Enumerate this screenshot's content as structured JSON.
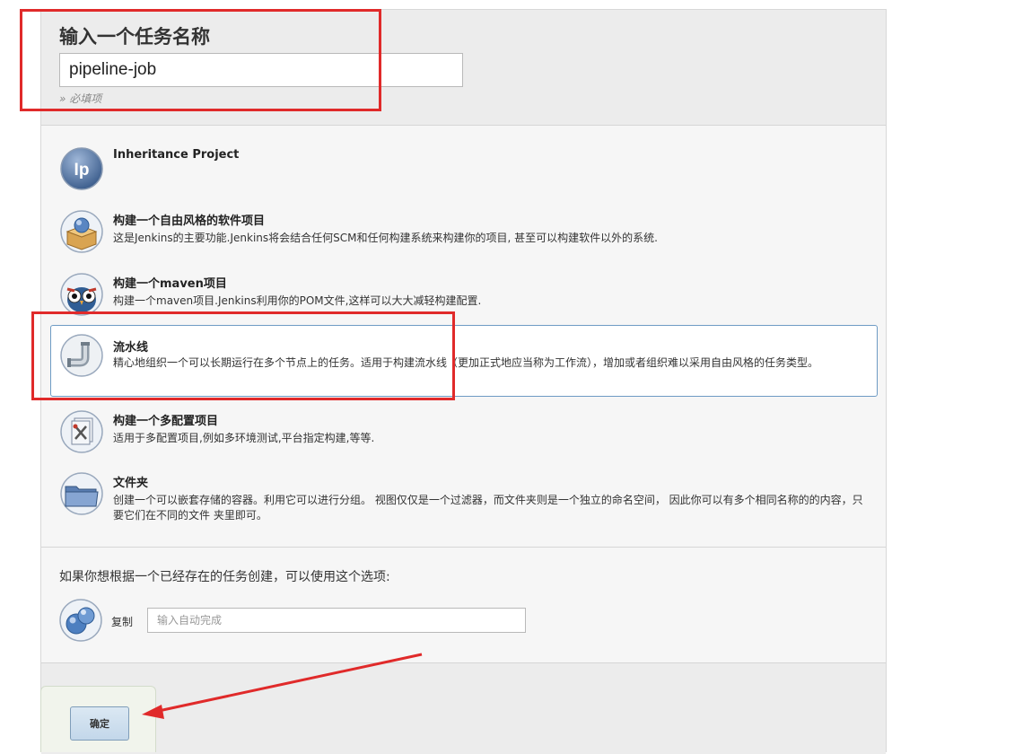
{
  "header": {
    "title": "输入一个任务名称",
    "job_name_value": "pipeline-job",
    "required_hint": "» 必填项"
  },
  "items": [
    {
      "icon": "inheritance-project-icon",
      "icon_text": "Ip",
      "title": "Inheritance Project",
      "desc": ""
    },
    {
      "icon": "freestyle-box-icon",
      "title": "构建一个自由风格的软件项目",
      "desc": "这是Jenkins的主要功能.Jenkins将会结合任何SCM和任何构建系统来构建你的项目, 甚至可以构建软件以外的系统."
    },
    {
      "icon": "maven-owl-icon",
      "title": "构建一个maven项目",
      "desc": "构建一个maven项目.Jenkins利用你的POM文件,这样可以大大减轻构建配置."
    },
    {
      "icon": "pipeline-pipe-icon",
      "title": "流水线",
      "desc": "精心地组织一个可以长期运行在多个节点上的任务。适用于构建流水线（更加正式地应当称为工作流），增加或者组织难以采用自由风格的任务类型。",
      "selected": true
    },
    {
      "icon": "multi-config-icon",
      "title": "构建一个多配置项目",
      "desc": "适用于多配置项目,例如多环境测试,平台指定构建,等等."
    },
    {
      "icon": "folder-icon",
      "title": "文件夹",
      "desc": "创建一个可以嵌套存储的容器。利用它可以进行分组。 视图仅仅是一个过滤器，而文件夹则是一个独立的命名空间， 因此你可以有多个相同名称的的内容，只要它们在不同的文件 夹里即可。"
    }
  ],
  "copy": {
    "prompt": "如果你想根据一个已经存在的任务创建，可以使用这个选项:",
    "label": "复制",
    "placeholder": "输入自动完成",
    "icon": "copy-spheres-icon"
  },
  "footer": {
    "ok_label": "确定"
  },
  "colors": {
    "annotation_red": "#e02a2a",
    "selected_border": "#6e9bc4",
    "panel_bg": "#f6f6f6"
  }
}
